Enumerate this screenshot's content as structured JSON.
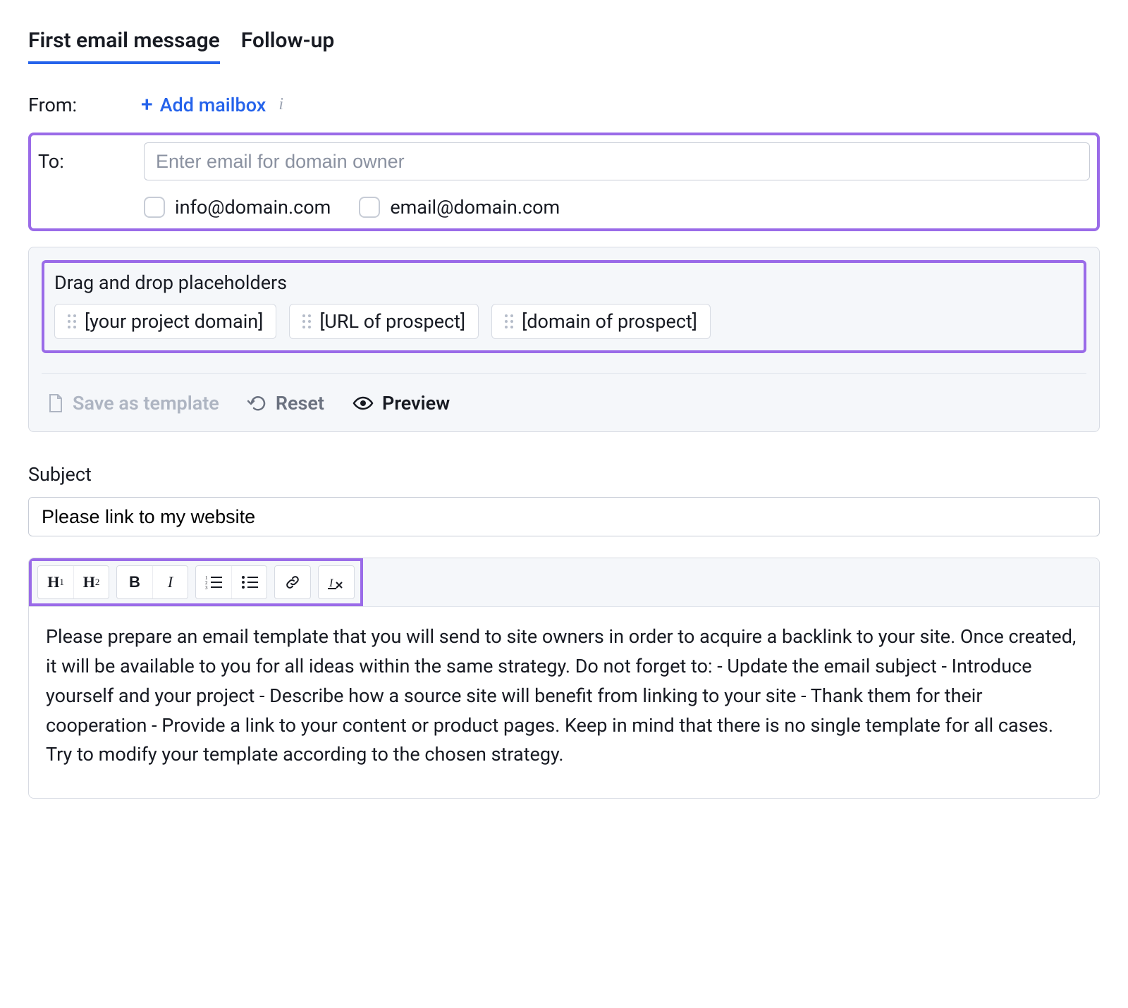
{
  "tabs": {
    "first": "First email message",
    "followup": "Follow-up"
  },
  "from": {
    "label": "From:",
    "add_mailbox": "Add mailbox"
  },
  "to": {
    "label": "To:",
    "placeholder": "Enter email for domain owner",
    "suggestions": [
      "info@domain.com",
      "email@domain.com"
    ]
  },
  "placeholders": {
    "title": "Drag and drop placeholders",
    "items": [
      "[your project domain]",
      "[URL of prospect]",
      "[domain of prospect]"
    ]
  },
  "panel_actions": {
    "save_template": "Save as template",
    "reset": "Reset",
    "preview": "Preview"
  },
  "subject": {
    "label": "Subject",
    "value": "Please link to my website"
  },
  "toolbar": {
    "h1": "H",
    "h2": "H",
    "bold": "B",
    "italic": "I"
  },
  "body_text": "Please prepare an email template that you will send to site owners in order to acquire a backlink to your site. Once created, it will be available to you for all ideas within the same strategy. Do not forget to: - Update the email subject - Introduce yourself and your project - Describe how a source site will benefit from linking to your site - Thank them for their cooperation - Provide a link to your content or product pages. Keep in mind that there is no single template for all cases. Try to modify your template according to the chosen strategy."
}
